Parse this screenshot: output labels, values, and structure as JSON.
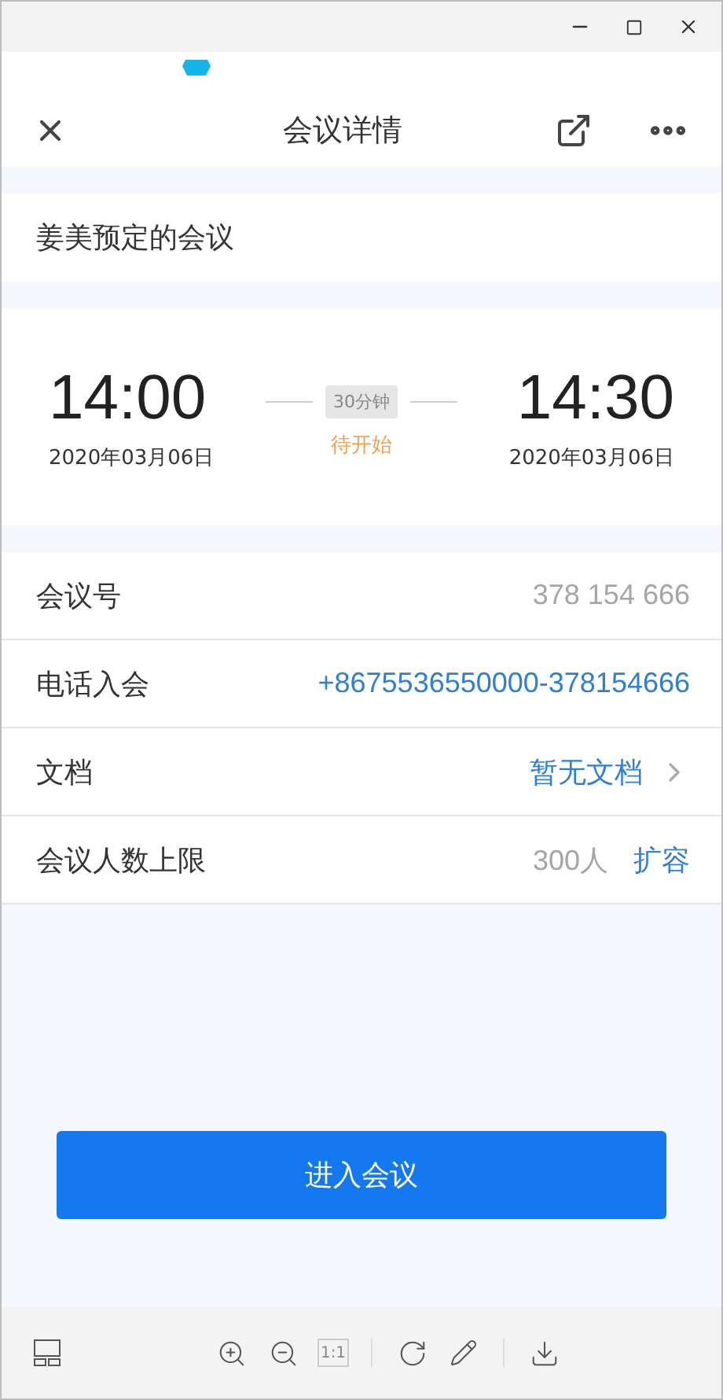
{
  "header": {
    "title": "会议详情"
  },
  "meeting": {
    "title": "姜美预定的会议"
  },
  "schedule": {
    "start": {
      "time": "14:00",
      "date": "2020年03月06日"
    },
    "duration": "30分钟",
    "status": "待开始",
    "end": {
      "time": "14:30",
      "date": "2020年03月06日"
    }
  },
  "details": [
    {
      "kind": "plain",
      "label": "会议号",
      "value": "378 154 666"
    },
    {
      "kind": "link",
      "label": "电话入会",
      "value": "+8675536550000-378154666"
    },
    {
      "kind": "nav",
      "label": "文档",
      "value": "暂无文档"
    },
    {
      "kind": "action",
      "label": "会议人数上限",
      "value": "300人",
      "action": "扩容"
    }
  ],
  "join_button": "进入会议",
  "toolbar": {
    "actual_size": {
      "label": "1:1",
      "disabled": true
    }
  }
}
